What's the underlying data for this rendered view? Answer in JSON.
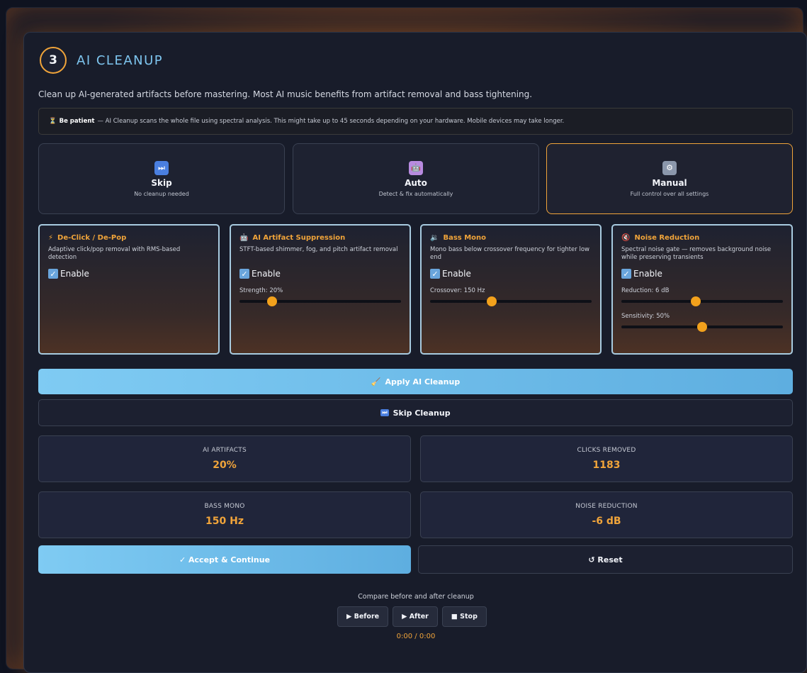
{
  "header": {
    "step": "3",
    "title": "AI CLEANUP"
  },
  "description": "Clean up AI-generated artifacts before mastering. Most AI music benefits from artifact removal and bass tightening.",
  "notice": {
    "icon": "hourglass-icon",
    "bold": "Be patient",
    "text": "— AI Cleanup scans the whole file using spectral analysis. This might take up to 45 seconds depending on your hardware. Mobile devices may take longer."
  },
  "modes": [
    {
      "title": "Skip",
      "sub": "No cleanup needed",
      "icon": "fast-forward-icon",
      "active": false
    },
    {
      "title": "Auto",
      "sub": "Detect & fix automatically",
      "icon": "robot-icon",
      "active": false
    },
    {
      "title": "Manual",
      "sub": "Full control over all settings",
      "icon": "control-knobs-icon",
      "active": true
    }
  ],
  "features": [
    {
      "title": "De-Click / De-Pop",
      "icon": "lightning-icon",
      "desc": "Adaptive click/pop removal with RMS-based detection",
      "enable": "Enable",
      "enabled": true,
      "sliders": []
    },
    {
      "title": "AI Artifact Suppression",
      "icon": "robot-icon",
      "desc": "STFT-based shimmer, fog, and pitch artifact removal",
      "enable": "Enable",
      "enabled": true,
      "sliders": [
        {
          "label": "Strength: 20%",
          "value": 0.2
        }
      ]
    },
    {
      "title": "Bass Mono",
      "icon": "speaker-icon",
      "desc": "Mono bass below crossover frequency for tighter low end",
      "enable": "Enable",
      "enabled": true,
      "sliders": [
        {
          "label": "Crossover: 150 Hz",
          "value": 0.38
        }
      ]
    },
    {
      "title": "Noise Reduction",
      "icon": "mute-speaker-icon",
      "desc": "Spectral noise gate — removes background noise while preserving transients",
      "enable": "Enable",
      "enabled": true,
      "sliders": [
        {
          "label": "Reduction: 6 dB",
          "value": 0.46
        },
        {
          "label": "Sensitivity: 50%",
          "value": 0.5
        }
      ]
    }
  ],
  "actions": {
    "apply": "Apply AI Cleanup",
    "skip": "Skip Cleanup"
  },
  "stats": [
    {
      "label": "AI ARTIFACTS",
      "value": "20%"
    },
    {
      "label": "CLICKS REMOVED",
      "value": "1183"
    },
    {
      "label": "BASS MONO",
      "value": "150 Hz"
    },
    {
      "label": "NOISE REDUCTION",
      "value": "-6 dB"
    }
  ],
  "footer": {
    "accept": "✓ Accept & Continue",
    "reset": "↺ Reset",
    "compare_label": "Compare before and after cleanup",
    "before": "▶ Before",
    "after": "▶ After",
    "stop": "■ Stop",
    "time": "0:00 / 0:00"
  },
  "colors": {
    "accent": "#f0a43a",
    "title_blue": "#7ec5ef",
    "button_blue": "#7fcbf3",
    "card_border": "#a8cbe0"
  }
}
